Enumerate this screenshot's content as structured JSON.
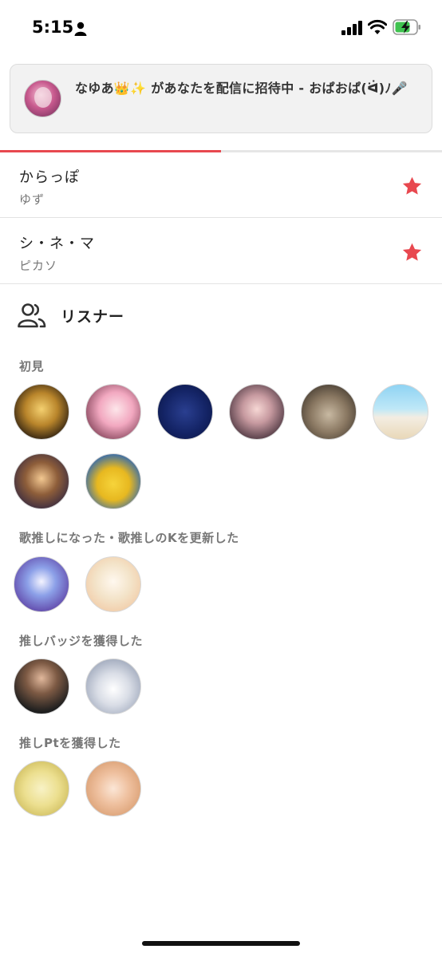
{
  "status_bar": {
    "time": "5:15"
  },
  "banner": {
    "text": "なゆあ👑✨ があなたを配信に招待中 - おぱおぱ(ᐛ)ﾉ🎤"
  },
  "progress": {
    "fraction": 0.5,
    "color": "#e8484f"
  },
  "favorites": [
    {
      "title": "からっぽ",
      "subtitle": "ゆず"
    },
    {
      "title": "シ・ネ・マ",
      "subtitle": "ピカソ"
    }
  ],
  "listeners": {
    "title": "リスナー",
    "sections": [
      {
        "label": "初見"
      },
      {
        "label": "歌推しになった・歌推しのKを更新した"
      },
      {
        "label": "推しバッジを獲得した"
      },
      {
        "label": "推しPtを獲得した"
      }
    ]
  },
  "colors": {
    "accent": "#e8484f",
    "star": "#e8484f"
  }
}
